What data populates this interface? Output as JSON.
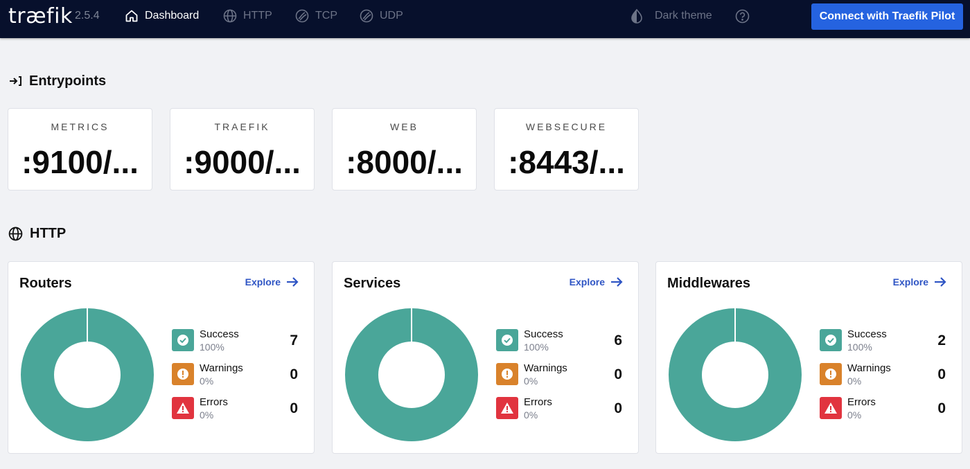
{
  "header": {
    "logo_text": "træfik",
    "version": "2.5.4",
    "nav": [
      {
        "label": "Dashboard",
        "icon": "home-icon"
      },
      {
        "label": "HTTP",
        "icon": "globe-icon"
      },
      {
        "label": "TCP",
        "icon": "tcp-icon"
      },
      {
        "label": "UDP",
        "icon": "udp-icon"
      }
    ],
    "theme_label": "Dark theme",
    "pilot_button": "Connect with Traefik Pilot"
  },
  "entrypoints": {
    "title": "Entrypoints",
    "items": [
      {
        "name": "METRICS",
        "address": ":9100/..."
      },
      {
        "name": "TRAEFIK",
        "address": ":9000/..."
      },
      {
        "name": "WEB",
        "address": ":8000/..."
      },
      {
        "name": "WEBSECURE",
        "address": ":8443/..."
      }
    ]
  },
  "http": {
    "title": "HTTP",
    "explore_label": "Explore",
    "cards": [
      {
        "title": "Routers",
        "legend": [
          {
            "label": "Success",
            "pct": "100%",
            "count": "7"
          },
          {
            "label": "Warnings",
            "pct": "0%",
            "count": "0"
          },
          {
            "label": "Errors",
            "pct": "0%",
            "count": "0"
          }
        ]
      },
      {
        "title": "Services",
        "legend": [
          {
            "label": "Success",
            "pct": "100%",
            "count": "6"
          },
          {
            "label": "Warnings",
            "pct": "0%",
            "count": "0"
          },
          {
            "label": "Errors",
            "pct": "0%",
            "count": "0"
          }
        ]
      },
      {
        "title": "Middlewares",
        "legend": [
          {
            "label": "Success",
            "pct": "100%",
            "count": "2"
          },
          {
            "label": "Warnings",
            "pct": "0%",
            "count": "0"
          },
          {
            "label": "Errors",
            "pct": "0%",
            "count": "0"
          }
        ]
      }
    ]
  },
  "colors": {
    "topbar": "#07102c",
    "accent": "#2563e0",
    "success": "#4aa699",
    "warning": "#d9822b",
    "error": "#e1343f"
  }
}
